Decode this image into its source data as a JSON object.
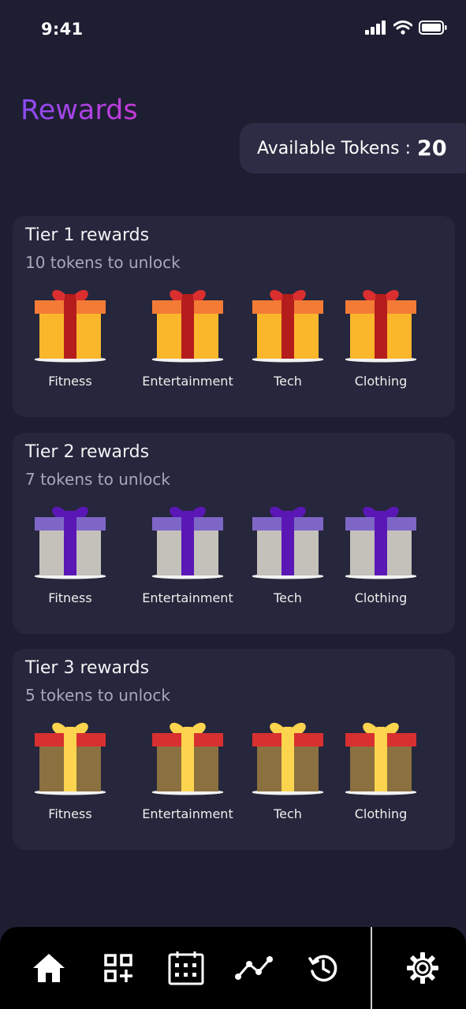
{
  "status": {
    "time": "9:41"
  },
  "header": {
    "title": "Rewards",
    "tokens_label": "Available Tokens :",
    "tokens_value": "20"
  },
  "tiers": [
    {
      "title": "Tier 1 rewards",
      "subtitle": "10 tokens to unlock",
      "colors": {
        "box": "#fbb72b",
        "lid": "#f47b36",
        "ribbon": "#b51c1c",
        "bow": "#db2f2f"
      },
      "items": [
        "Fitness",
        "Entertainment",
        "Tech",
        "Clothing"
      ]
    },
    {
      "title": "Tier 2 rewards",
      "subtitle": "7 tokens to unlock",
      "colors": {
        "box": "#c4c1bb",
        "lid": "#7e66c6",
        "ribbon": "#5a17b6",
        "bow": "#5a17b6"
      },
      "items": [
        "Fitness",
        "Entertainment",
        "Tech",
        "Clothing"
      ]
    },
    {
      "title": "Tier 3 rewards",
      "subtitle": "5 tokens to unlock",
      "colors": {
        "box": "#8b7040",
        "lid": "#d83030",
        "ribbon": "#fcd44e",
        "bow": "#fcd44e"
      },
      "items": [
        "Fitness",
        "Entertainment",
        "Tech",
        "Clothing"
      ]
    }
  ],
  "nav": {
    "items": [
      "home-icon",
      "qr-add-icon",
      "calendar-icon",
      "analytics-icon",
      "history-icon",
      "settings-icon"
    ],
    "active": "home-icon"
  }
}
